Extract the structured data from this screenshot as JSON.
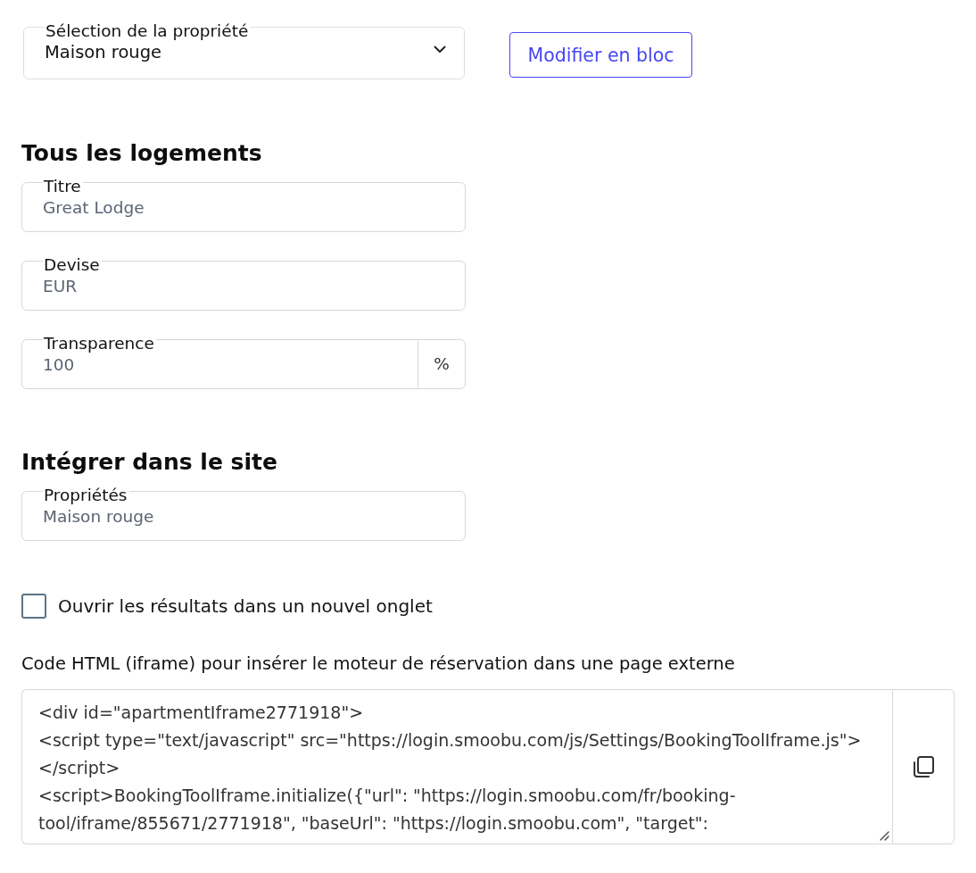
{
  "property_select": {
    "label": "Sélection de la propriété",
    "value": "Maison rouge"
  },
  "bulk_edit_button": {
    "label": "Modifier en bloc"
  },
  "sections": [
    {
      "heading": "Tous les logements",
      "fields": [
        {
          "label": "Titre",
          "value": "Great Lodge"
        },
        {
          "label": "Devise",
          "value": "EUR"
        },
        {
          "label": "Transparence",
          "value": "100",
          "suffix": "%"
        }
      ]
    },
    {
      "heading": "Intégrer dans le site",
      "fields": [
        {
          "label": "Propriétés",
          "value": "Maison rouge"
        }
      ]
    }
  ],
  "new_tab_checkbox": {
    "label": "Ouvrir les résultats dans un nouvel onglet",
    "checked": false
  },
  "embed_code": {
    "label": "Code HTML (iframe) pour insérer le moteur de réservation dans une page externe",
    "lines": [
      "<div id=\"apartmentIframe2771918\">",
      "<script type=\"text/javascript\" src=\"https://login.smoobu.com/js/Settings/BookingToolIframe.js\">",
      "</script>",
      "<script>BookingToolIframe.initialize({\"url\": \"https://login.smoobu.com/fr/booking-",
      "tool/iframe/855671/2771918\", \"baseUrl\": \"https://login.smoobu.com\", \"target\":"
    ]
  }
}
